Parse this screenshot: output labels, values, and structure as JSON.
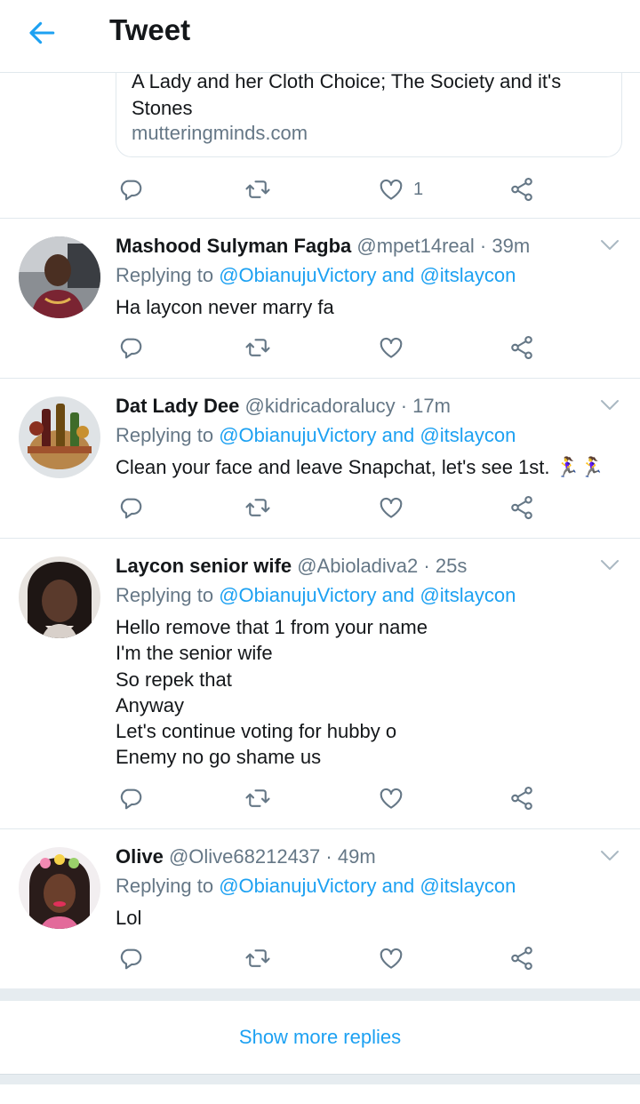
{
  "header": {
    "title": "Tweet",
    "back_icon": "arrow-left-icon"
  },
  "link_card": {
    "title": "A Lady and her Cloth Choice; The Society and it's Stones",
    "domain": "mutteringminds.com",
    "like_count": "1"
  },
  "replying_label": "Replying to",
  "replying_and": "and",
  "replies": [
    {
      "name": "Mashood Sulyman Fagba",
      "handle": "@mpet14real",
      "time": "39m",
      "mention1": "@ObianujuVictory",
      "mention2": "@itslaycon",
      "lines": [
        "Ha laycon never marry fa"
      ]
    },
    {
      "name": "Dat Lady Dee",
      "handle": "@kidricadoralucy",
      "time": "17m",
      "mention1": "@ObianujuVictory",
      "mention2": "@itslaycon",
      "lines": [
        "Clean your face and leave Snapchat, let's see 1st. 🏃‍♀️🏃‍♀️"
      ]
    },
    {
      "name": "Laycon senior wife",
      "handle": "@Abioladiva2",
      "time": "25s",
      "mention1": "@ObianujuVictory",
      "mention2": "@itslaycon",
      "lines": [
        "Hello remove that 1 from your name",
        "I'm the senior wife",
        "So repek that",
        "Anyway",
        "Let's continue voting for hubby o",
        "Enemy no go shame us"
      ]
    },
    {
      "name": "Olive",
      "handle": "@Olive68212437",
      "time": "49m",
      "mention1": "@ObianujuVictory",
      "mention2": "@itslaycon",
      "lines": [
        "Lol"
      ]
    }
  ],
  "show_more": "Show more replies",
  "colors": {
    "accent": "#1da1f2",
    "secondary_text": "#657786",
    "divider": "#e1e8ed"
  },
  "icons": {
    "reply": "reply-icon",
    "retweet": "retweet-icon",
    "like": "heart-icon",
    "share": "share-icon",
    "menu": "chevron-down-icon"
  }
}
